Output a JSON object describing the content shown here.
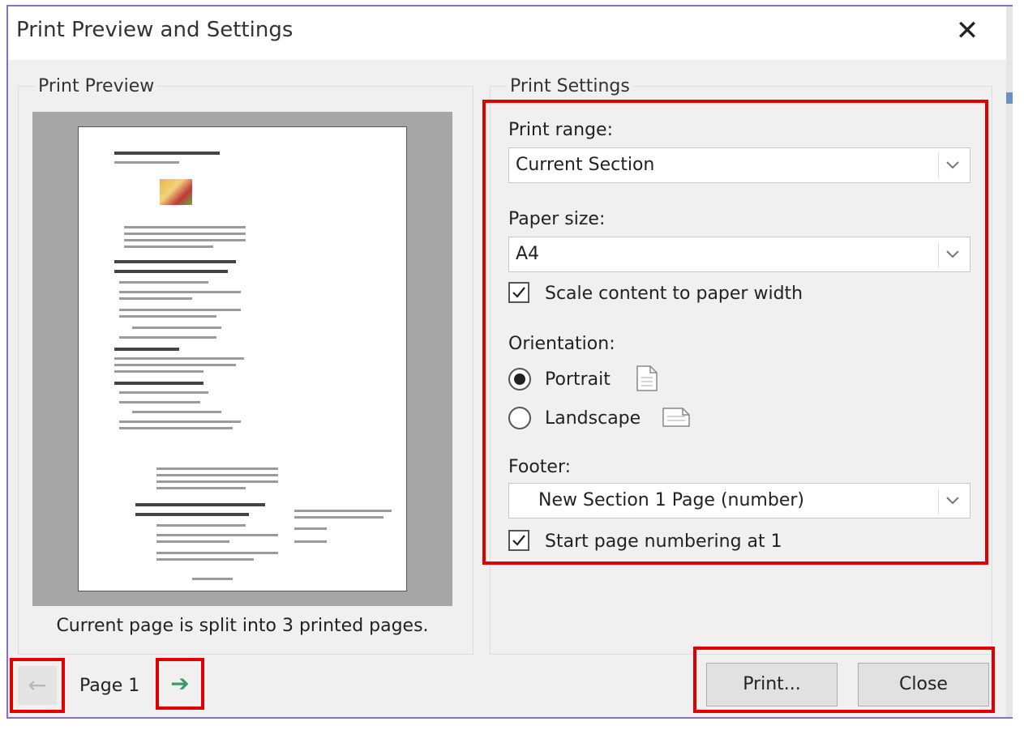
{
  "dialog": {
    "title": "Print Preview and Settings",
    "close_glyph": "✕"
  },
  "preview": {
    "group_title": "Print Preview",
    "caption": "Current page is split into 3 printed pages.",
    "page_label": "Page 1",
    "prev_glyph": "←",
    "next_glyph": "➔"
  },
  "settings": {
    "group_title": "Print Settings",
    "print_range": {
      "label": "Print range:",
      "value": "Current Section"
    },
    "paper_size": {
      "label": "Paper size:",
      "value": "A4"
    },
    "scale_content": {
      "label": "Scale content to paper width",
      "checked": true
    },
    "orientation": {
      "label": "Orientation:",
      "portrait": "Portrait",
      "landscape": "Landscape",
      "selected": "Portrait"
    },
    "footer": {
      "label": "Footer:",
      "value": "New Section 1 Page (number)"
    },
    "start_numbering": {
      "label": "Start page numbering at 1",
      "checked": true
    }
  },
  "buttons": {
    "print": "Print...",
    "close": "Close"
  },
  "colors": {
    "highlight": "#e00000",
    "dialog_border": "#8b6cc7",
    "next_arrow": "#3a9a6a"
  }
}
